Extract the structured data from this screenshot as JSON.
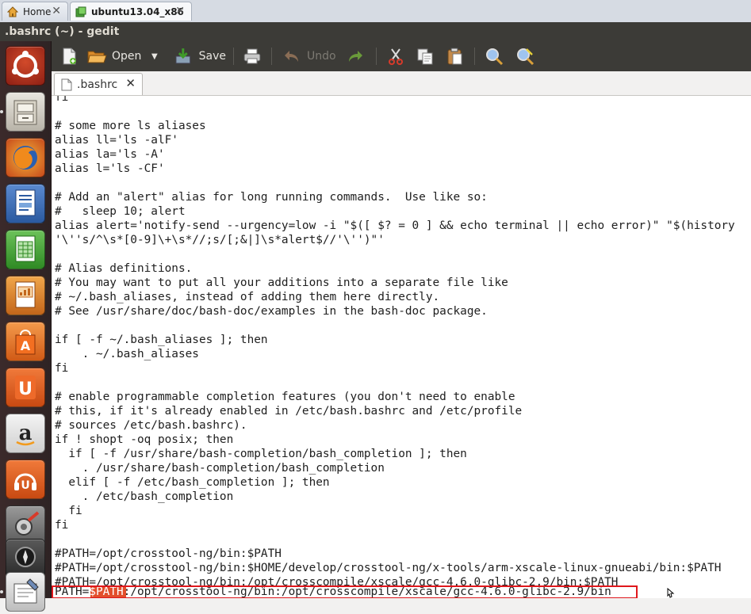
{
  "vbox_tabs": {
    "home_label": "Home",
    "active_label": "ubuntu13.04_x86",
    "close_glyph": "✕"
  },
  "window": {
    "title": ".bashrc (~) - gedit"
  },
  "toolbar": {
    "open_label": "Open",
    "save_label": "Save",
    "undo_label": "Undo"
  },
  "doc_tab": {
    "label": ".bashrc",
    "close_glyph": "✕"
  },
  "editor": {
    "lines": [
      "fi",
      "",
      "# some more ls aliases",
      "alias ll='ls -alF'",
      "alias la='ls -A'",
      "alias l='ls -CF'",
      "",
      "# Add an \"alert\" alias for long running commands.  Use like so:",
      "#   sleep 10; alert",
      "alias alert='notify-send --urgency=low -i \"$([ $? = 0 ] && echo terminal || echo error)\" \"$(history",
      "'\\''s/^\\s*[0-9]\\+\\s*//;s/[;&|]\\s*alert$//'\\'')\"'",
      "",
      "# Alias definitions.",
      "# You may want to put all your additions into a separate file like",
      "# ~/.bash_aliases, instead of adding them here directly.",
      "# See /usr/share/doc/bash-doc/examples in the bash-doc package.",
      "",
      "if [ -f ~/.bash_aliases ]; then",
      "    . ~/.bash_aliases",
      "fi",
      "",
      "# enable programmable completion features (you don't need to enable",
      "# this, if it's already enabled in /etc/bash.bashrc and /etc/profile",
      "# sources /etc/bash.bashrc).",
      "if ! shopt -oq posix; then",
      "  if [ -f /usr/share/bash-completion/bash_completion ]; then",
      "    . /usr/share/bash-completion/bash_completion",
      "  elif [ -f /etc/bash_completion ]; then",
      "    . /etc/bash_completion",
      "  fi",
      "fi",
      "",
      "#PATH=/opt/crosstool-ng/bin:$PATH",
      "#PATH=/opt/crosstool-ng/bin:$HOME/develop/crosstool-ng/x-tools/arm-xscale-linux-gnueabi/bin:$PATH",
      "#PATH=/opt/crosstool-ng/bin:/opt/crosscompile/xscale/gcc-4.6.0-glibc-2.9/bin:$PATH"
    ],
    "last_line": {
      "prefix": "PATH=",
      "highlighted": "$PATH",
      "suffix": ":/opt/crosstool-ng/bin:/opt/crosscompile/xscale/gcc-4.6.0-glibc-2.9/bin"
    }
  },
  "launcher": {
    "items": [
      "ubuntu-dash",
      "files",
      "firefox",
      "libreoffice-writer",
      "libreoffice-calc",
      "libreoffice-impress",
      "ubuntu-software-center",
      "ubuntu-one",
      "amazon",
      "ubuntu-one-music",
      "system-settings",
      "workspaces",
      "gedit"
    ]
  },
  "colors": {
    "title_bar": "#3c3b37",
    "launcher_bg": "#3a2b2c",
    "highlight_box": "#e0171c",
    "highlight_fill": "#e24e2b"
  }
}
